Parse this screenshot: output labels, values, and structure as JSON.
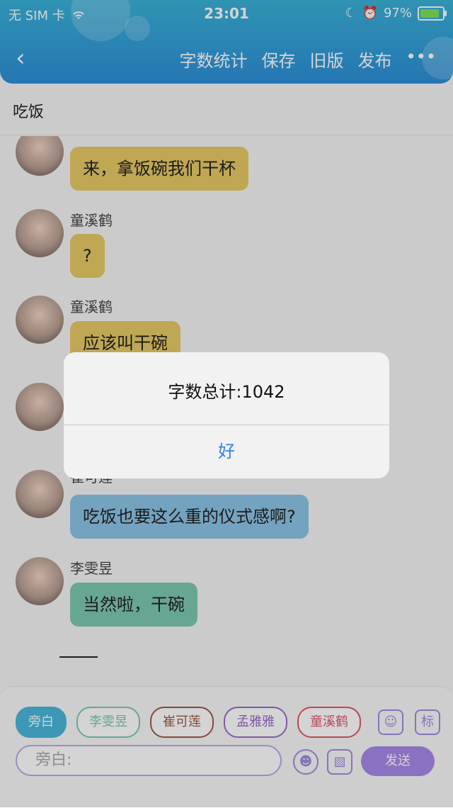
{
  "status_bar": {
    "carrier": "无 SIM 卡",
    "time": "23:01",
    "battery": "97%",
    "icons": [
      "wifi-icon",
      "moon-icon",
      "alarm-icon",
      "battery-icon"
    ]
  },
  "header": {
    "actions": [
      "字数统计",
      "保存",
      "旧版",
      "发布"
    ],
    "more": "•••"
  },
  "title": "吃饭",
  "messages": [
    {
      "name": "",
      "text": "来，拿饭碗我们干杯",
      "color": "#e7c965"
    },
    {
      "name": "童溪鹤",
      "text": "?",
      "color": "#e7c965"
    },
    {
      "name": "童溪鹤",
      "text": "应该叫干碗",
      "color": "#e7c965"
    },
    {
      "name": "崔可莲",
      "text": "吃饭也要这么重的仪式感啊?",
      "color": "#8cc4e6"
    },
    {
      "name": "李雯昱",
      "text": "当然啦，干碗",
      "color": "#7ec8b3"
    }
  ],
  "dialog": {
    "message": "字数总计:1042",
    "ok": "好"
  },
  "composer": {
    "chips": [
      {
        "label": "旁白",
        "color": "#4ab6dc",
        "active": true
      },
      {
        "label": "李雯昱",
        "color": "#7ec8b3",
        "active": false
      },
      {
        "label": "崔可莲",
        "color": "#a05a45",
        "active": false
      },
      {
        "label": "孟雅雅",
        "color": "#9b6cc8",
        "active": false
      },
      {
        "label": "童溪鹤",
        "color": "#e2566a",
        "active": false
      }
    ],
    "tag_label": "标",
    "placeholder": "旁白:",
    "send": "发送"
  }
}
